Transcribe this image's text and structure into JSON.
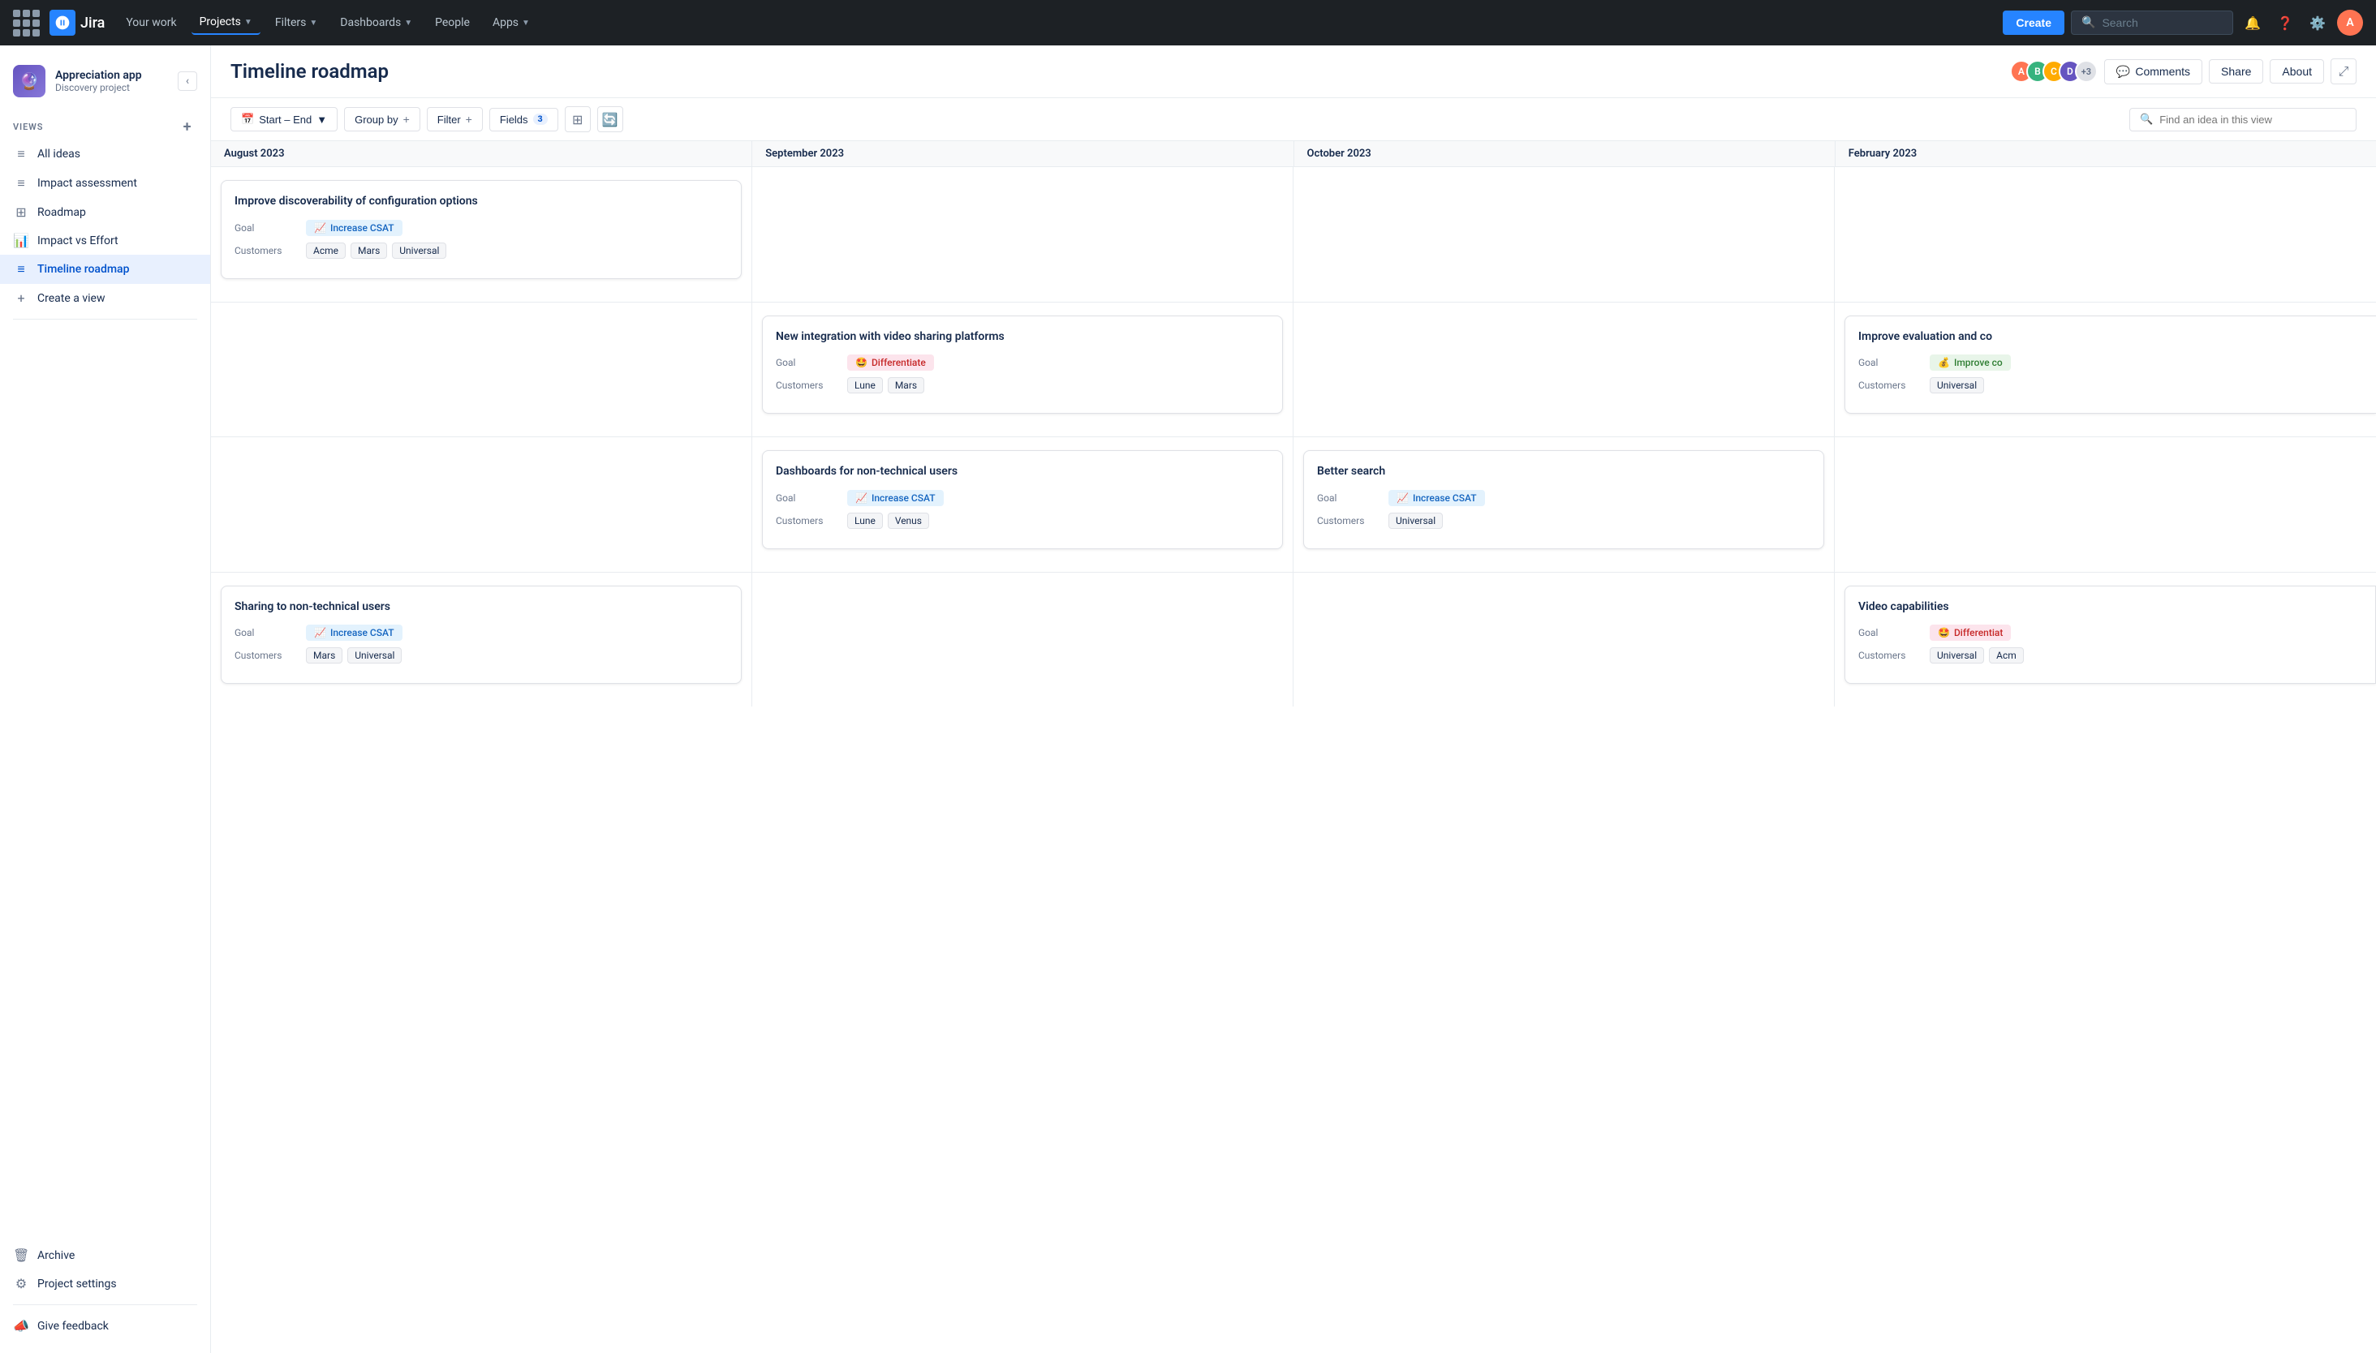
{
  "topnav": {
    "logo_text": "Jira",
    "items": [
      {
        "label": "Your work",
        "id": "your-work",
        "has_chevron": false
      },
      {
        "label": "Projects",
        "id": "projects",
        "has_chevron": true,
        "active": true
      },
      {
        "label": "Filters",
        "id": "filters",
        "has_chevron": true
      },
      {
        "label": "Dashboards",
        "id": "dashboards",
        "has_chevron": true
      },
      {
        "label": "People",
        "id": "people",
        "has_chevron": false
      },
      {
        "label": "Apps",
        "id": "apps",
        "has_chevron": true
      }
    ],
    "create_label": "Create",
    "search_placeholder": "Search"
  },
  "sidebar": {
    "project_name": "Appreciation app",
    "project_subtitle": "Discovery project",
    "views_label": "VIEWS",
    "nav_items": [
      {
        "label": "All ideas",
        "id": "all-ideas",
        "icon": "≡"
      },
      {
        "label": "Impact assessment",
        "id": "impact-assessment",
        "icon": "≡"
      },
      {
        "label": "Roadmap",
        "id": "roadmap",
        "icon": "⊞"
      },
      {
        "label": "Impact vs Effort",
        "id": "impact-effort",
        "icon": "📈"
      },
      {
        "label": "Timeline roadmap",
        "id": "timeline-roadmap",
        "icon": "≡",
        "active": true
      },
      {
        "label": "Create a view",
        "id": "create-view",
        "icon": "+"
      }
    ],
    "archive_label": "Archive",
    "project_settings_label": "Project settings",
    "give_feedback_label": "Give feedback"
  },
  "page": {
    "title": "Timeline roadmap",
    "header_buttons": {
      "comments": "Comments",
      "share": "Share",
      "about": "About"
    },
    "avatar_count": "+3"
  },
  "toolbar": {
    "start_end": "Start – End",
    "group_by": "Group by",
    "filter": "Filter",
    "fields": "Fields",
    "fields_count": "3",
    "search_placeholder": "Find an idea in this view"
  },
  "timeline": {
    "months": [
      {
        "label": "August 2023",
        "id": "aug"
      },
      {
        "label": "September 2023",
        "id": "sep"
      },
      {
        "label": "October 2023",
        "id": "oct"
      },
      {
        "label": "February 2023",
        "id": "feb"
      }
    ],
    "rows": [
      {
        "id": "row1",
        "cells": [
          {
            "col": 0,
            "cards": [
              {
                "id": "card1",
                "title": "Improve discoverability of configuration options",
                "goal_label": "Goal",
                "goal_icon": "📈",
                "goal_text": "Increase CSAT",
                "goal_type": "increase-csat",
                "customers_label": "Customers",
                "customers": [
                  "Acme",
                  "Mars",
                  "Universal"
                ]
              }
            ]
          },
          {
            "col": 1,
            "cards": []
          },
          {
            "col": 2,
            "cards": []
          },
          {
            "col": 3,
            "cards": []
          }
        ]
      },
      {
        "id": "row2",
        "cells": [
          {
            "col": 0,
            "cards": []
          },
          {
            "col": 1,
            "cards": [
              {
                "id": "card2",
                "title": "New integration with video sharing platforms",
                "goal_label": "Goal",
                "goal_icon": "🤩",
                "goal_text": "Differentiate",
                "goal_type": "differentiate",
                "customers_label": "Customers",
                "customers": [
                  "Lune",
                  "Mars"
                ]
              }
            ]
          },
          {
            "col": 2,
            "cards": []
          },
          {
            "col": 3,
            "cards": [
              {
                "id": "card3",
                "title": "Improve evaluation and co",
                "goal_label": "Goal",
                "goal_icon": "💰",
                "goal_text": "Improve co",
                "goal_type": "improve-co",
                "customers_label": "Customers",
                "customers": [
                  "Universal"
                ],
                "partial": true
              }
            ]
          }
        ]
      },
      {
        "id": "row3",
        "cells": [
          {
            "col": 0,
            "cards": []
          },
          {
            "col": 1,
            "cards": [
              {
                "id": "card4",
                "title": "Dashboards for non-technical users",
                "goal_label": "Goal",
                "goal_icon": "📈",
                "goal_text": "Increase CSAT",
                "goal_type": "increase-csat",
                "customers_label": "Customers",
                "customers": [
                  "Lune",
                  "Venus"
                ]
              }
            ]
          },
          {
            "col": 2,
            "cards": [
              {
                "id": "card5",
                "title": "Better search",
                "goal_label": "Goal",
                "goal_icon": "📈",
                "goal_text": "Increase CSAT",
                "goal_type": "increase-csat",
                "customers_label": "Customers",
                "customers": [
                  "Universal"
                ]
              }
            ]
          },
          {
            "col": 3,
            "cards": []
          }
        ]
      },
      {
        "id": "row4",
        "cells": [
          {
            "col": 0,
            "cards": [
              {
                "id": "card6",
                "title": "Sharing to non-technical users",
                "goal_label": "Goal",
                "goal_icon": "📈",
                "goal_text": "Increase CSAT",
                "goal_type": "increase-csat",
                "customers_label": "Customers",
                "customers": [
                  "Mars",
                  "Universal"
                ]
              }
            ]
          },
          {
            "col": 1,
            "cards": []
          },
          {
            "col": 2,
            "cards": []
          },
          {
            "col": 3,
            "cards": [
              {
                "id": "card7",
                "title": "Video capabilities",
                "goal_label": "Goal",
                "goal_icon": "🤩",
                "goal_text": "Differentiat",
                "goal_type": "differentiate",
                "customers_label": "Customers",
                "customers": [
                  "Universal",
                  "Acm"
                ],
                "partial": true
              }
            ]
          }
        ]
      }
    ]
  },
  "colors": {
    "accent_blue": "#2684ff",
    "nav_bg": "#1d2125",
    "sidebar_bg": "#ffffff",
    "active_item": "#e8f0fe",
    "card_border": "#dfe1e6"
  }
}
